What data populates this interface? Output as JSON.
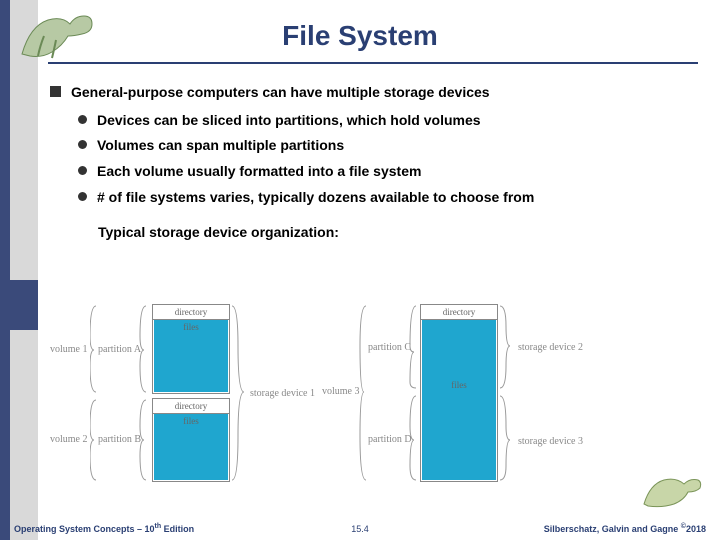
{
  "title": "File System",
  "bullet_top": "General-purpose computers can have multiple storage devices",
  "subs": {
    "s0": "Devices can be sliced into partitions, which hold volumes",
    "s1": "Volumes can span multiple partitions",
    "s2": "Each volume usually formatted into a file system",
    "s3": "# of file systems varies, typically dozens available to choose from"
  },
  "caption": "Typical storage device organization:",
  "diagram": {
    "vol1": "volume 1",
    "vol2": "volume 2",
    "vol3": "volume 3",
    "pa": "partition A",
    "pb": "partition B",
    "pc": "partition C",
    "pd": "partition D",
    "dir": "directory",
    "files": "files",
    "sd1": "storage device 1",
    "sd2": "storage device 2",
    "sd3": "storage device 3"
  },
  "footer": {
    "left_a": "Operating System Concepts – 10",
    "left_b": " Edition",
    "center": "15.4",
    "right_a": "Silberschatz, Galvin and Gagne ",
    "right_b": "2018"
  }
}
